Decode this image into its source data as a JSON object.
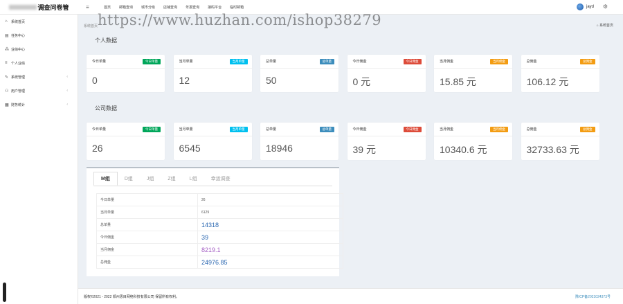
{
  "app": {
    "title": "调查问卷管"
  },
  "topnav": [
    "首页",
    "邮箱查询",
    "城市分级",
    "店铺查询",
    "年报查询",
    "接码平台",
    "临时邮箱"
  ],
  "user": {
    "name": "jayd"
  },
  "sidebar": {
    "items": [
      {
        "label": "系统首页",
        "icon": "home-icon",
        "arrow": ""
      },
      {
        "label": "任务中心",
        "icon": "list-icon",
        "arrow": ""
      },
      {
        "label": "业绩中心",
        "icon": "org-icon",
        "arrow": ""
      },
      {
        "label": "个人业绩",
        "icon": "menu-icon",
        "arrow": ""
      },
      {
        "label": "系统管理",
        "icon": "wrench-icon",
        "arrow": "‹"
      },
      {
        "label": "用户管理",
        "icon": "users-icon",
        "arrow": "‹"
      },
      {
        "label": "财务统计",
        "icon": "table-icon",
        "arrow": "‹"
      }
    ]
  },
  "watermark": "https://www.huzhan.com/ishop38279",
  "breadcrumb": {
    "head": "系统首页",
    "right": "系统首页"
  },
  "sections": {
    "personal": "个人数据",
    "company": "公司数据"
  },
  "personal_cards": [
    {
      "label": "今日单量",
      "badge": "今日单量",
      "value": "0",
      "color": "#00a65a"
    },
    {
      "label": "当月单量",
      "badge": "当月单量",
      "value": "12",
      "color": "#00c0ef"
    },
    {
      "label": "总单量",
      "badge": "总单量",
      "value": "50",
      "color": "#3c8dbc"
    },
    {
      "label": "今日佣金",
      "badge": "今日佣金",
      "value": "0 元",
      "color": "#dd4b39"
    },
    {
      "label": "当月佣金",
      "badge": "当月佣金",
      "value": "15.85 元",
      "color": "#f39c12"
    },
    {
      "label": "总佣金",
      "badge": "总佣金",
      "value": "106.12 元",
      "color": "#f39c12"
    }
  ],
  "company_cards": [
    {
      "label": "今日单量",
      "badge": "今日单量",
      "value": "26",
      "color": "#00a65a"
    },
    {
      "label": "当月单量",
      "badge": "当月单量",
      "value": "6545",
      "color": "#00c0ef"
    },
    {
      "label": "总单量",
      "badge": "总单量",
      "value": "18946",
      "color": "#3c8dbc"
    },
    {
      "label": "今日佣金",
      "badge": "今日佣金",
      "value": "39 元",
      "color": "#dd4b39"
    },
    {
      "label": "当月佣金",
      "badge": "当月佣金",
      "value": "10340.6 元",
      "color": "#f39c12"
    },
    {
      "label": "总佣金",
      "badge": "总佣金",
      "value": "32733.63 元",
      "color": "#f39c12"
    }
  ],
  "tabs": [
    "M组",
    "D组",
    "J组",
    "Z组",
    "L组",
    "幸运调查"
  ],
  "stats": [
    {
      "key": "今日单量",
      "value": "26",
      "style": "small"
    },
    {
      "key": "当月单量",
      "value": "6129",
      "style": "small"
    },
    {
      "key": "总单量",
      "value": "14318",
      "style": ""
    },
    {
      "key": "今日佣金",
      "value": "39",
      "style": ""
    },
    {
      "key": "当月佣金",
      "value": "8219.1",
      "style": "purple"
    },
    {
      "key": "总佣金",
      "value": "24976.85",
      "style": ""
    }
  ],
  "footer": {
    "copy": "版权©2021 - 2022 郑州思目网络科技有限公司 保留所有权利。",
    "icp": "豫ICP备2021024373号"
  }
}
